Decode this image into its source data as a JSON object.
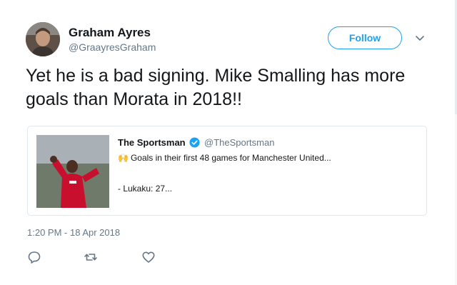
{
  "author": {
    "name": "Graham Ayres",
    "handle": "@GraayresGraham"
  },
  "follow_label": "Follow",
  "tweet_text": "Yet he is a bad signing. Mike Smalling has more goals than Morata in 2018!!",
  "quoted": {
    "name": "The Sportsman",
    "handle": "@TheSportsman",
    "emoji": "🙌",
    "line1": "Goals in their first 48 games for Manchester United...",
    "line2": "- Lukaku: 27..."
  },
  "timestamp": "1:20 PM - 18 Apr 2018",
  "icons": {
    "reply": "reply-icon",
    "retweet": "retweet-icon",
    "like": "heart-icon",
    "verified": "verified-badge-icon",
    "more": "chevron-down-icon"
  },
  "colors": {
    "accent": "#1da1f2",
    "text": "#14171a",
    "muted": "#657786",
    "border": "#e1e8ed"
  }
}
